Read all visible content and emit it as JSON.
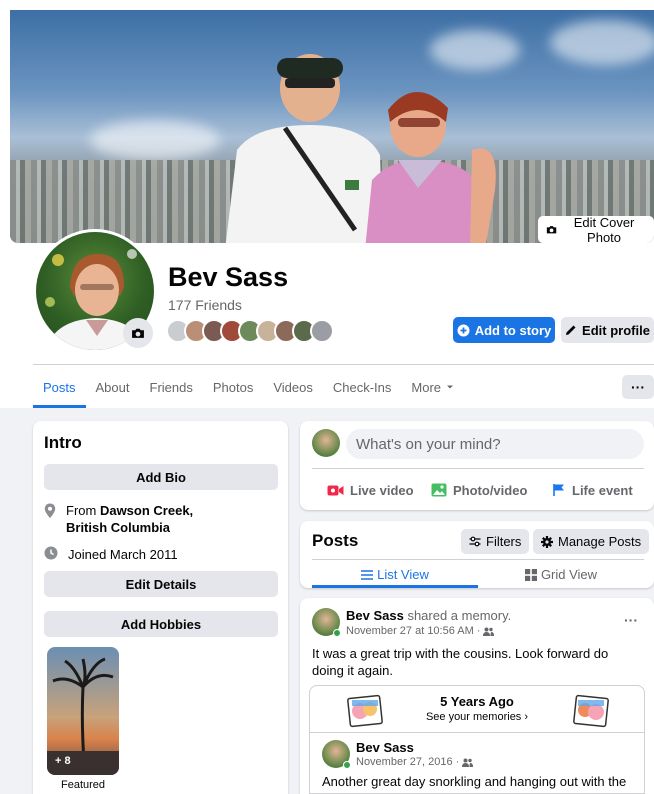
{
  "cover": {
    "edit_label": "Edit Cover Photo"
  },
  "profile": {
    "name": "Bev Sass",
    "friends_count": "177 Friends",
    "add_story_label": "Add to story",
    "edit_profile_label": "Edit profile"
  },
  "tabs": {
    "items": [
      "Posts",
      "About",
      "Friends",
      "Photos",
      "Videos",
      "Check-Ins",
      "More"
    ],
    "more_dots": "···"
  },
  "intro": {
    "title": "Intro",
    "add_bio": "Add Bio",
    "from_prefix": "From ",
    "from_place": "Dawson Creek, British Columbia",
    "joined": "Joined March 2011",
    "edit_details": "Edit Details",
    "add_hobbies": "Add Hobbies",
    "featured_count": "+ 8",
    "featured_label": "Featured"
  },
  "composer": {
    "placeholder": "What's on your mind?",
    "live_video": "Live video",
    "photo_video": "Photo/video",
    "life_event": "Life event"
  },
  "posts_header": {
    "title": "Posts",
    "filters": "Filters",
    "manage": "Manage Posts",
    "list_view": "List View",
    "grid_view": "Grid View"
  },
  "post": {
    "author": "Bev Sass",
    "action": " shared a memory.",
    "timestamp": "November 27 at 10:56 AM",
    "dot": "·",
    "dots": "···",
    "text": "It was a great trip with the cousins.  Look forward do doing it again.",
    "memory": {
      "title": "5 Years Ago",
      "link": "See your memories",
      "chevron": "›",
      "inner_author": "Bev Sass",
      "inner_timestamp": "November 27, 2016",
      "inner_text": "Another great day snorkling and hanging out with the"
    }
  },
  "colors": {
    "accent": "#1b74e4",
    "gray_button": "#e4e6eb",
    "page_bg": "#f0f2f5",
    "online": "#31a24c"
  }
}
